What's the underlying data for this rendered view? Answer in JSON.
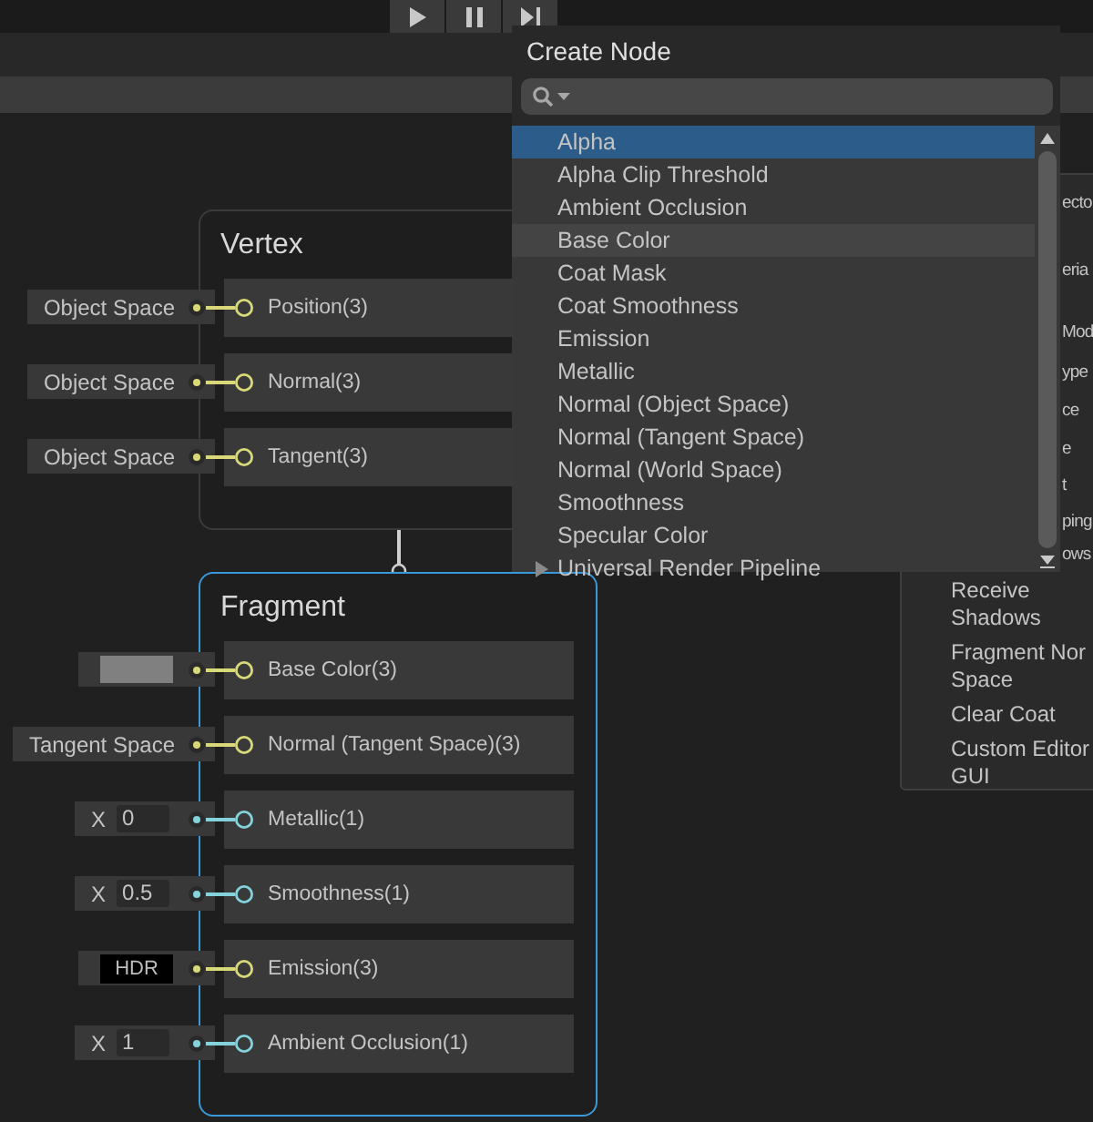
{
  "toolbar": {
    "buttons": [
      {
        "kind": "play"
      },
      {
        "kind": "pause"
      },
      {
        "kind": "step"
      }
    ]
  },
  "inspector": {
    "fragments": [
      "ecto",
      "eria",
      "Mod",
      "ype",
      "ce",
      "e",
      "t",
      "ping",
      "ows"
    ],
    "items": [
      {
        "lines": [
          "Receive",
          "Shadows"
        ]
      },
      {
        "lines": [
          "Fragment Nor",
          "Space"
        ]
      },
      {
        "lines": [
          "Clear Coat"
        ]
      },
      {
        "lines": [
          "Custom Editor",
          "GUI"
        ]
      }
    ]
  },
  "nodes": [
    {
      "title": "Vertex",
      "selected": false,
      "ports": [
        {
          "label": "Position(3)",
          "color": "#d9d97a",
          "input": {
            "kind": "dropdown",
            "value": "Object Space"
          }
        },
        {
          "label": "Normal(3)",
          "color": "#d9d97a",
          "input": {
            "kind": "dropdown",
            "value": "Object Space"
          }
        },
        {
          "label": "Tangent(3)",
          "color": "#d9d97a",
          "input": {
            "kind": "dropdown",
            "value": "Object Space"
          }
        }
      ]
    },
    {
      "title": "Fragment",
      "selected": true,
      "ports": [
        {
          "label": "Base Color(3)",
          "color": "#d9d97a",
          "input": {
            "kind": "swatch",
            "color": "#808080"
          }
        },
        {
          "label": "Normal (Tangent Space)(3)",
          "color": "#d9d97a",
          "input": {
            "kind": "dropdown",
            "value": "Tangent Space"
          }
        },
        {
          "label": "Metallic(1)",
          "color": "#84d2dc",
          "input": {
            "kind": "float",
            "axis": "X",
            "value": "0"
          }
        },
        {
          "label": "Smoothness(1)",
          "color": "#84d2dc",
          "input": {
            "kind": "float",
            "axis": "X",
            "value": "0.5"
          }
        },
        {
          "label": "Emission(3)",
          "color": "#d9d97a",
          "input": {
            "kind": "hdr",
            "value": "HDR"
          }
        },
        {
          "label": "Ambient Occlusion(1)",
          "color": "#84d2dc",
          "input": {
            "kind": "float",
            "axis": "X",
            "value": "1"
          }
        }
      ]
    }
  ],
  "create_node": {
    "title": "Create Node",
    "items": [
      {
        "label": "Alpha",
        "kind": "item",
        "selected": true,
        "hovered": false
      },
      {
        "label": "Alpha Clip Threshold",
        "kind": "item",
        "selected": false,
        "hovered": false
      },
      {
        "label": "Ambient Occlusion",
        "kind": "item",
        "selected": false,
        "hovered": false
      },
      {
        "label": "Base Color",
        "kind": "item",
        "selected": false,
        "hovered": true
      },
      {
        "label": "Coat Mask",
        "kind": "item",
        "selected": false,
        "hovered": false
      },
      {
        "label": "Coat Smoothness",
        "kind": "item",
        "selected": false,
        "hovered": false
      },
      {
        "label": "Emission",
        "kind": "item",
        "selected": false,
        "hovered": false
      },
      {
        "label": "Metallic",
        "kind": "item",
        "selected": false,
        "hovered": false
      },
      {
        "label": "Normal (Object Space)",
        "kind": "item",
        "selected": false,
        "hovered": false
      },
      {
        "label": "Normal (Tangent Space)",
        "kind": "item",
        "selected": false,
        "hovered": false
      },
      {
        "label": "Normal (World Space)",
        "kind": "item",
        "selected": false,
        "hovered": false
      },
      {
        "label": "Smoothness",
        "kind": "item",
        "selected": false,
        "hovered": false
      },
      {
        "label": "Specular Color",
        "kind": "item",
        "selected": false,
        "hovered": false
      },
      {
        "label": "Universal Render Pipeline",
        "kind": "group",
        "selected": false,
        "hovered": false
      }
    ]
  }
}
